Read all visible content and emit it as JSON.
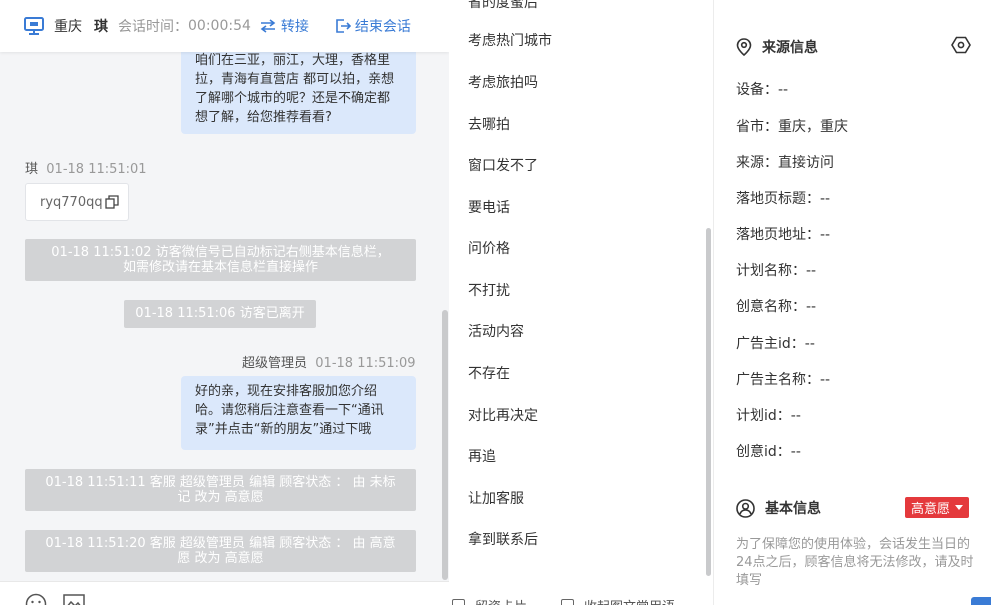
{
  "header": {
    "city": "重庆",
    "user": "琪",
    "session_time_label": "会话时间：",
    "session_time": "00:00:54",
    "transfer_label": "转接",
    "end_label": "结束会话"
  },
  "messages": {
    "bubble1": "咱们在三亚，丽江，大理，香格里拉，青海有直营店 都可以拍，亲想了解哪个城市的呢？还是不确定都想了解，给您推荐看看?",
    "visitor_name": "琪",
    "visitor_time": "01-18 11:51:01",
    "visitor_text": "ryq770qq",
    "sys1_line1": "01-18 11:51:02 访客微信号已自动标记右侧基本信息栏，",
    "sys1_line2": "如需修改请在基本信息栏直接操作",
    "sys2": "01-18 11:51:06 访客已离开",
    "admin_name": "超级管理员",
    "admin_time": "01-18 11:51:09",
    "bubble2": "好的亲，现在安排客服加您介绍哈。请您稍后注意查看一下“通讯录”并点击“新的朋友”通过下哦",
    "sys3_line1": "01-18 11:51:11 客服 超级管理员 编辑 顾客状态 ： 由 未标",
    "sys3_line2": "记 改为 高意愿",
    "sys4_line1": "01-18 11:51:20 客服 超级管理员 编辑 顾客状态 ： 由 高意",
    "sys4_line2": "愿 改为 高意愿"
  },
  "quick_replies": {
    "items": [
      "考虑热门城市",
      "考虑旅拍吗",
      "去哪拍",
      "窗口发不了",
      "要电话",
      "问价格",
      "不打扰",
      "活动内容",
      "不存在",
      "对比再决定",
      "再追",
      "让加客服",
      "拿到联系后"
    ],
    "footer_left": "留资卡片",
    "footer_right": "收起图文常用语"
  },
  "source_info": {
    "title": "来源信息",
    "fields": [
      "设备：--",
      "省市：重庆，重庆",
      "来源：直接访问",
      "落地页标题：--",
      "落地页地址：--",
      "计划名称：--",
      "创意名称：--",
      "广告主id：--",
      "广告主名称：--",
      "计划id：--",
      "创意id：--"
    ]
  },
  "basic_info": {
    "title": "基本信息",
    "status": "高意愿",
    "note": "为了保障您的使用体验，会话发生当日的24点之后，顾客信息将无法修改，请及时填写"
  }
}
